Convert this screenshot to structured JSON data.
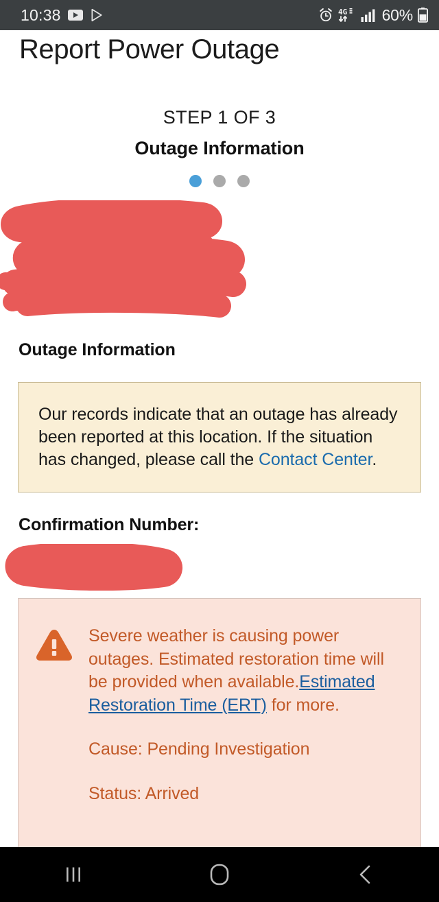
{
  "status_bar": {
    "time": "10:38",
    "battery_text": "60%",
    "left_icons": [
      "youtube-icon",
      "play-store-icon"
    ],
    "right_icons": [
      "alarm-icon",
      "4g-lte-data-icon",
      "signal-bars-icon",
      "battery-icon"
    ],
    "background_color": "#3b3f41",
    "text_color": "#f2f2f2"
  },
  "header": {
    "title": "Report Power Outage"
  },
  "step": {
    "counter": "STEP 1 OF 3",
    "name": "Outage Information",
    "dots": [
      {
        "state": "active",
        "color": "#4a9fd8"
      },
      {
        "state": "inactive",
        "color": "#aaaaaa"
      },
      {
        "state": "inactive",
        "color": "#aaaaaa"
      }
    ]
  },
  "redactions": {
    "top_block": {
      "label": "redacted-address-block",
      "color": "#e85a58"
    },
    "confirmation_value": {
      "label": "redacted-confirmation-number",
      "color": "#e85a58"
    }
  },
  "sections": {
    "outage_information_heading": "Outage Information",
    "confirmation_number_heading": "Confirmation Number:"
  },
  "info_box": {
    "text_before_link": "Our records indicate that an outage has already been reported at this location. If the situation has changed, please call the ",
    "link_label": "Contact Center",
    "text_after_link": ".",
    "background_color": "#faefd6",
    "border_color": "#c9bb95",
    "link_color": "#1a6bad"
  },
  "alert_box": {
    "icon": "warning-triangle-icon",
    "icon_color": "#d9642a",
    "background_color": "#fbe3da",
    "border_color": "#d7c4bd",
    "text_color": "#c25a28",
    "message_before_link": "Severe weather is causing power outages. Estimated restoration time will be provided when available.",
    "link_label": "Estimated Restoration Time (ERT)",
    "message_after_link": " for more.",
    "cause_line": "Cause: Pending Investigation",
    "status_line": "Status: Arrived",
    "link_color": "#1a5d9e"
  },
  "nav_bar": {
    "background_color": "#000000",
    "buttons": [
      {
        "name": "recents-button",
        "icon": "recents-icon"
      },
      {
        "name": "home-button",
        "icon": "home-icon"
      },
      {
        "name": "back-button",
        "icon": "back-chevron-icon"
      }
    ]
  }
}
